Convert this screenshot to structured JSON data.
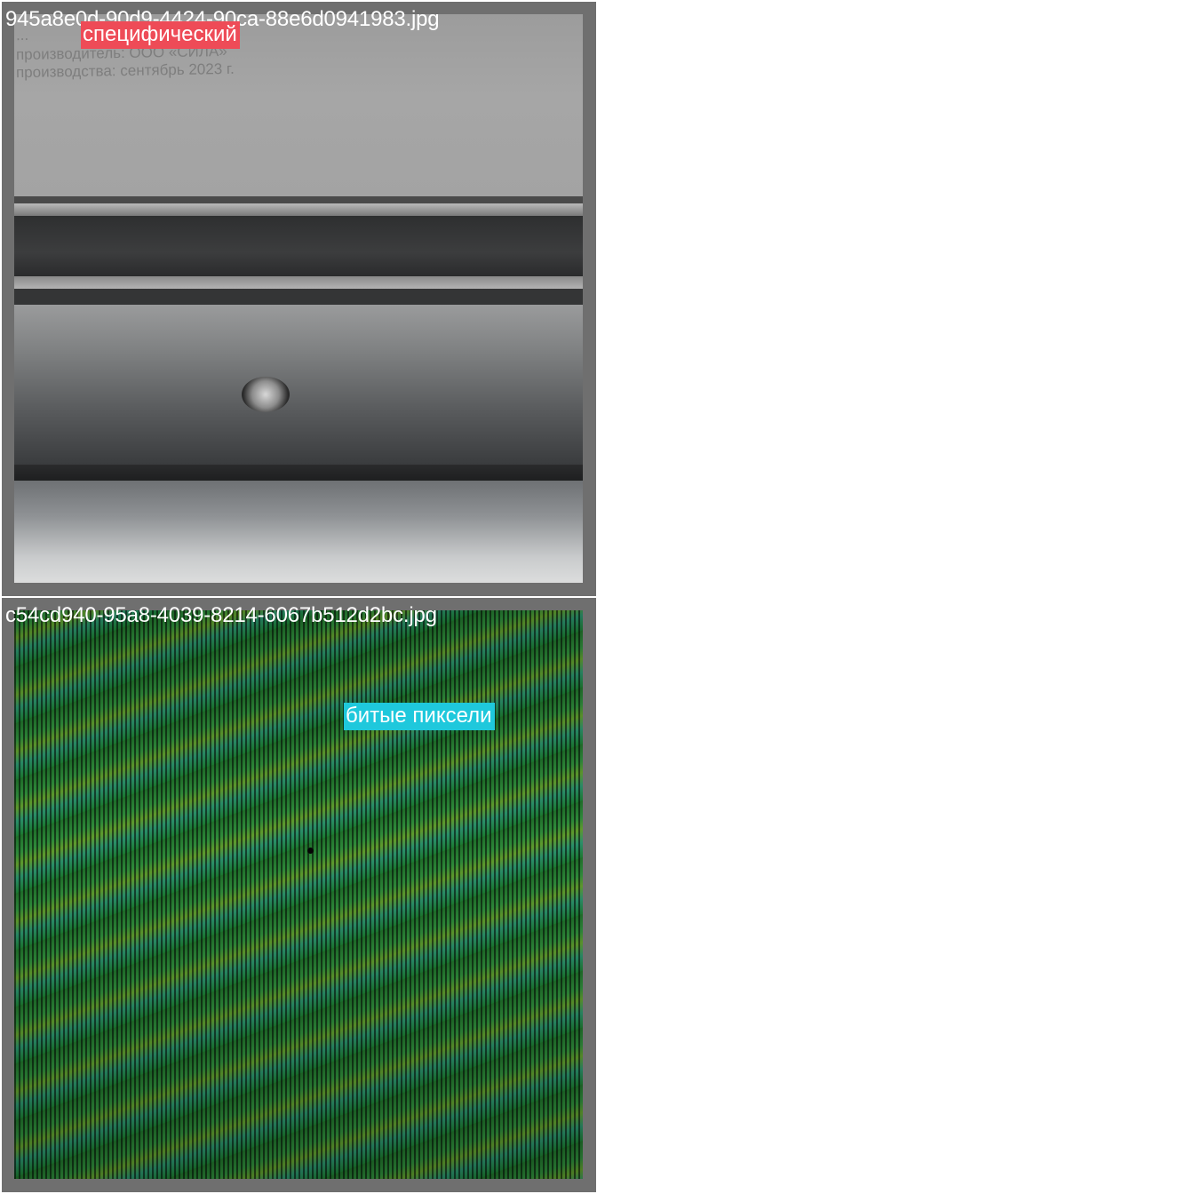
{
  "tiles": [
    {
      "filename": "945a8e0d-90d9-4424-90ca-88e6d0941983.jpg",
      "label": "специфический",
      "label_color": "#ee4b57",
      "photo_text": [
        "...",
        "производитель: ООО «СИЛА»",
        "производства: сентябрь 2023 г."
      ]
    },
    {
      "filename": "c54cd940-95a8-4039-8214-6067b512d2bc.jpg",
      "label": "битые пиксели",
      "label_color": "#1fc8dc"
    }
  ]
}
